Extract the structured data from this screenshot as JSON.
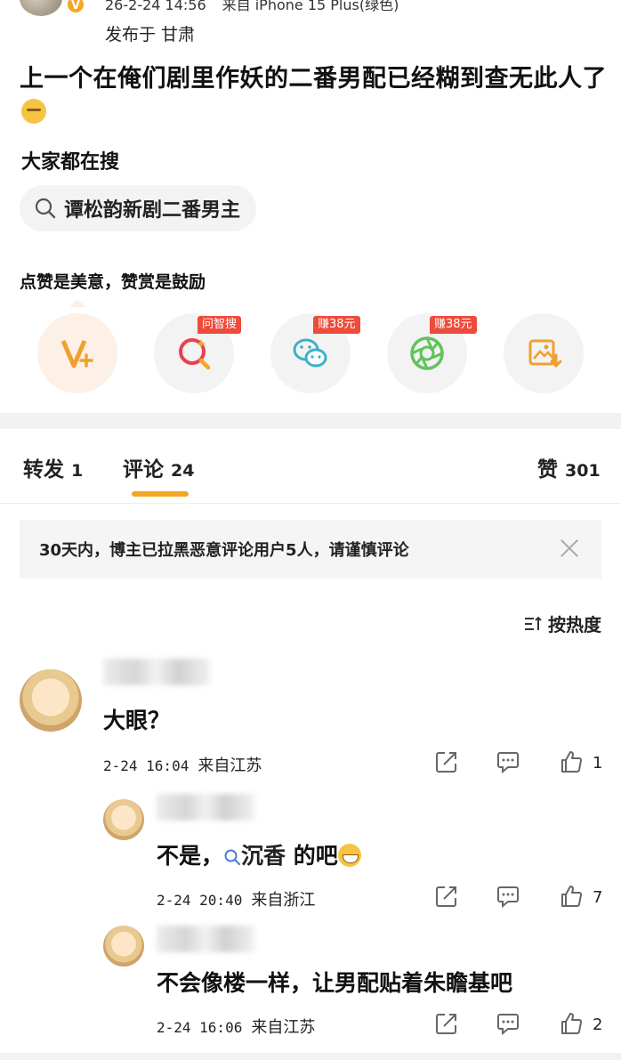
{
  "post": {
    "date": "26-2-24 14:56",
    "source": "来自 iPhone 15 Plus(绿色)",
    "publish_location": "发布于 甘肃",
    "title": "上一个在俺们剧里作妖的二番男配已经糊到查无此人了"
  },
  "trending": {
    "label": "大家都在搜",
    "query": "谭松韵新剧二番男主"
  },
  "rewards": {
    "hint": "点赞是美意，赞赏是鼓励",
    "items": [
      {
        "icon": "vplus-icon",
        "tag": ""
      },
      {
        "icon": "ai-search-icon",
        "tag": "问智搜"
      },
      {
        "icon": "wechat-icon",
        "tag": "赚38元"
      },
      {
        "icon": "moments-icon",
        "tag": "赚38元"
      },
      {
        "icon": "save-image-icon",
        "tag": ""
      }
    ]
  },
  "tabs": {
    "repost_label": "转发",
    "repost_count": "1",
    "comment_label": "评论",
    "comment_count": "24",
    "like_label": "赞",
    "like_count": "301"
  },
  "notice": "30天内，博主已拉黑恶意评论用户5人，请谨慎评论",
  "sort_label": "按热度",
  "comments": [
    {
      "text": "大眼？",
      "time": "2-24 16:04",
      "location": "来自江苏",
      "likes": "1"
    },
    {
      "text_prefix": "不是，",
      "link": "沉香",
      "text_suffix": " 的吧",
      "time": "2-24 20:40",
      "location": "来自浙江",
      "likes": "7"
    },
    {
      "text": "不会像楼一样，让男配贴着朱瞻基吧",
      "time": "2-24 16:06",
      "location": "来自江苏",
      "likes": "2"
    }
  ],
  "colors": {
    "accent": "#f5a623",
    "tag_red": "#ee4b3a",
    "wechat_blue": "#3bb0c9",
    "moments_green": "#62c25b"
  }
}
